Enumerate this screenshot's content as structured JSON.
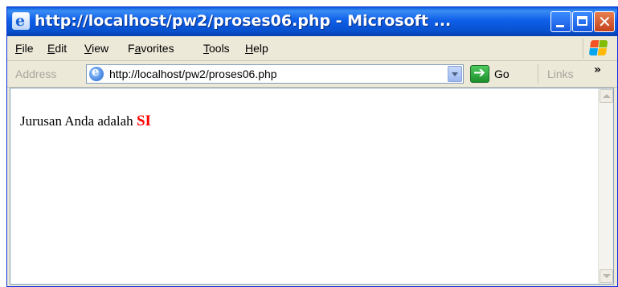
{
  "window": {
    "title": "http://localhost/pw2/proses06.php - Microsoft ..."
  },
  "menu": {
    "items": [
      {
        "pre": "",
        "key": "F",
        "post": "ile"
      },
      {
        "pre": "",
        "key": "E",
        "post": "dit"
      },
      {
        "pre": "",
        "key": "V",
        "post": "iew"
      },
      {
        "pre": "F",
        "key": "a",
        "post": "vorites"
      },
      {
        "pre": "",
        "key": "T",
        "post": "ools"
      },
      {
        "pre": "",
        "key": "H",
        "post": "elp"
      }
    ]
  },
  "address_bar": {
    "label": "Address",
    "url": "http://localhost/pw2/proses06.php",
    "go_label": "Go",
    "links_label": "Links",
    "links_chevron": "»"
  },
  "page": {
    "text": "Jurusan Anda adalah ",
    "highlight": "SI",
    "highlight_color": "#ff0000"
  },
  "icons": {
    "ie": "ie-logo-icon",
    "windows": "windows-flag-icon",
    "go": "go-arrow-icon"
  }
}
